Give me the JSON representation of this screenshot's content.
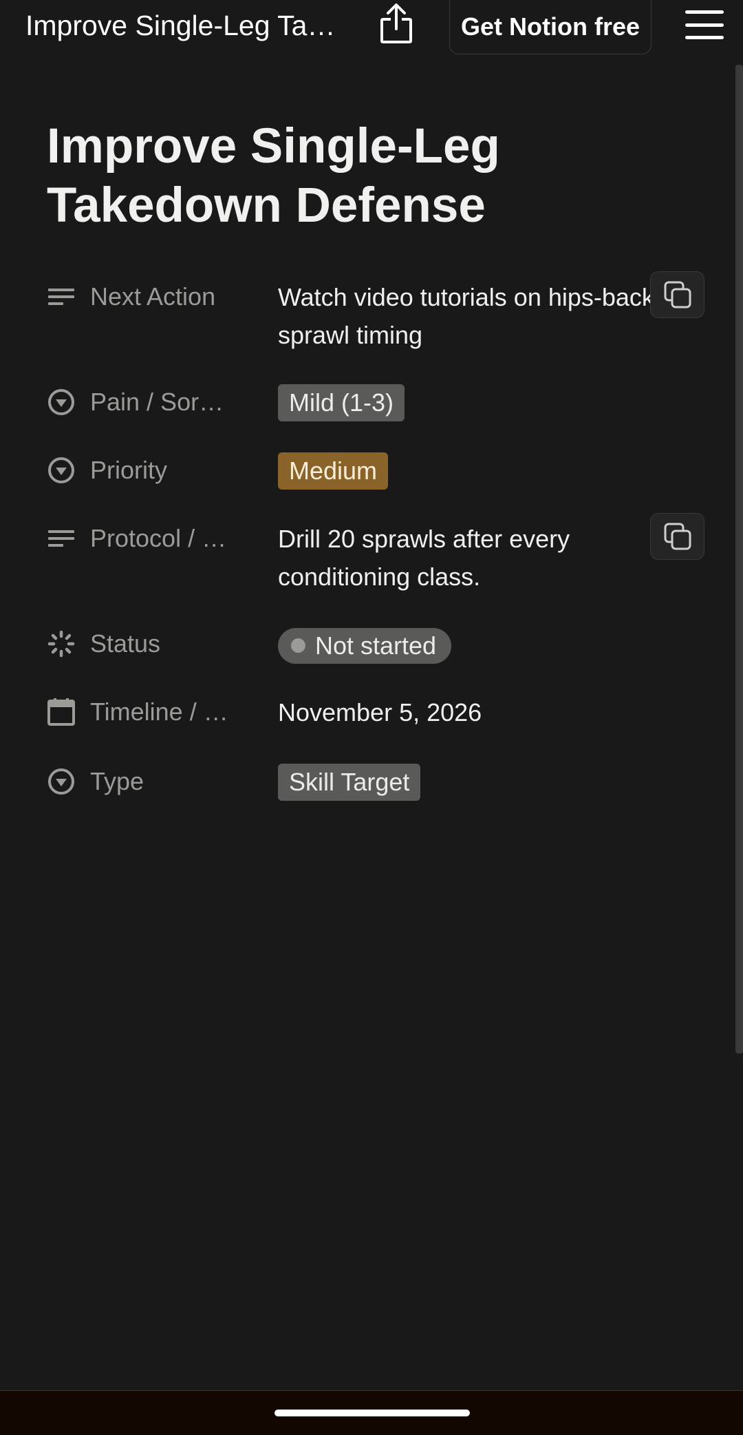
{
  "header": {
    "title": "Improve Single-Leg Tak…",
    "share_icon": "share-icon",
    "cta_label": "Get Notion free",
    "menu_icon": "hamburger-menu-icon"
  },
  "page": {
    "title": "Improve Single-Leg Takedown Defense",
    "properties": [
      {
        "label": "Next Action",
        "icon": "text-lines-icon",
        "type": "text",
        "value": "Watch video tutorials on hips-back sprawl timing"
      },
      {
        "label": "Pain / Sore…",
        "icon": "select-icon",
        "type": "select",
        "value": "Mild (1-3)",
        "color": "#5a5a58"
      },
      {
        "label": "Priority",
        "icon": "select-icon",
        "type": "select",
        "value": "Medium",
        "color": "#89632a"
      },
      {
        "label": "Protocol / …",
        "icon": "text-lines-icon",
        "type": "text",
        "value": "Drill 20 sprawls after every conditioning class."
      },
      {
        "label": "Status",
        "icon": "status-spinner-icon",
        "type": "status",
        "value": "Not started"
      },
      {
        "label": "Timeline / …",
        "icon": "calendar-icon",
        "type": "date",
        "value": "November 5, 2026"
      },
      {
        "label": "Type",
        "icon": "select-icon",
        "type": "select",
        "value": "Skill Target",
        "color": "#5a5a58"
      }
    ]
  },
  "colors": {
    "background": "#191919",
    "label_text": "#9b9b98",
    "value_text": "#f0f0ee",
    "tag_gray": "#5a5a58",
    "tag_brown": "#89632a"
  }
}
